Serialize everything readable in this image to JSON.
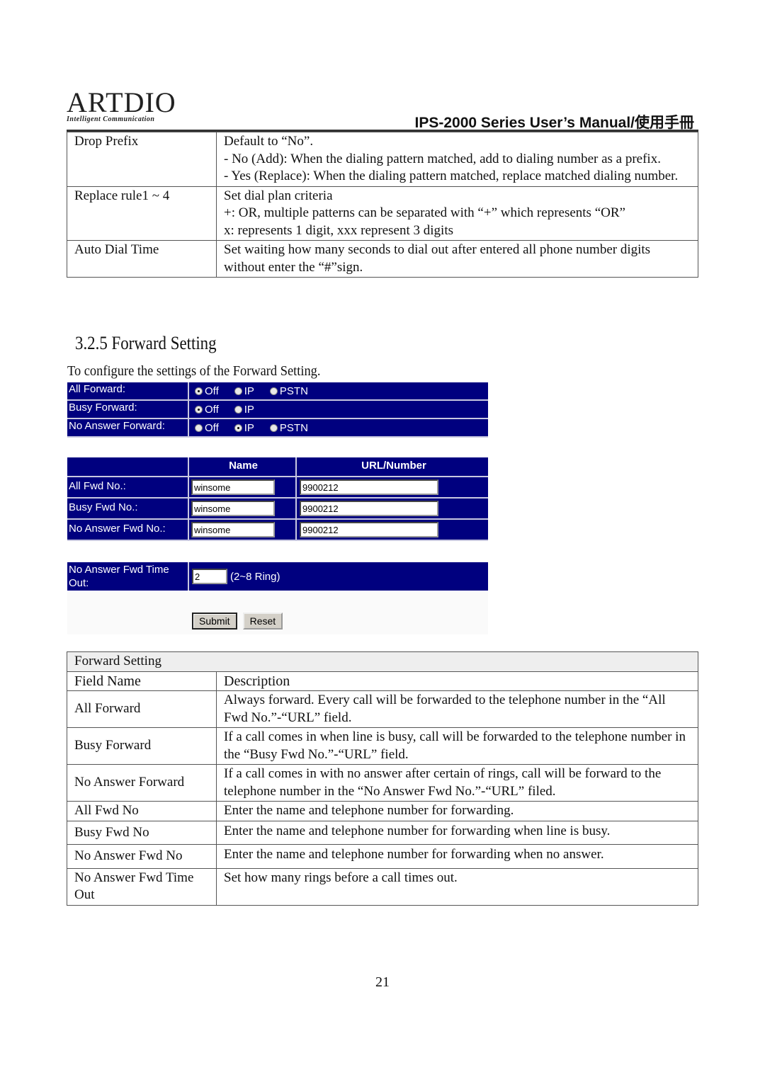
{
  "header": {
    "logo_main": "ARTDIO",
    "logo_tagline": "Intelligent Communication",
    "manual_title": "IPS-2000 Series User’s Manual/使用手冊"
  },
  "top_table": {
    "rows": [
      {
        "field": "Drop Prefix",
        "lines": [
          "Default to “No”.",
          "- No (Add): When the dialing pattern matched, add to dialing number as a prefix.",
          "- Yes (Replace): When the dialing pattern matched, replace matched dialing number."
        ]
      },
      {
        "field": "Replace rule1 ~ 4",
        "lines": [
          "Set dial plan criteria",
          "+: OR, multiple patterns can be separated with “+” which represents “OR”",
          "x: represents 1 digit, xxx represent 3 digits"
        ]
      },
      {
        "field": "Auto Dial Time",
        "lines": [
          "Set waiting how many seconds to dial out after entered all phone number digits without enter the “#”sign."
        ]
      }
    ]
  },
  "section": {
    "title": "3.2.5 Forward Setting",
    "intro": "To configure the settings of the Forward Setting."
  },
  "forward_form": {
    "modes": [
      {
        "label": "All Forward:",
        "options": [
          "Off",
          "IP",
          "PSTN"
        ],
        "selected": "Off"
      },
      {
        "label": "Busy Forward:",
        "options": [
          "Off",
          "IP"
        ],
        "selected": "Off"
      },
      {
        "label": "No Answer Forward:",
        "options": [
          "Off",
          "IP",
          "PSTN"
        ],
        "selected": "IP"
      }
    ],
    "grid_headers": {
      "name": "Name",
      "url": "URL/Number"
    },
    "numbers": [
      {
        "label": "All Fwd No.:",
        "name": "winsome",
        "url": "9900212"
      },
      {
        "label": "Busy Fwd No.:",
        "name": "winsome",
        "url": "9900212"
      },
      {
        "label": "No Answer Fwd No.:",
        "name": "winsome",
        "url": "9900212"
      }
    ],
    "timeout": {
      "label": "No Answer Fwd Time Out:",
      "value": "2",
      "hint": "(2~8 Ring)"
    },
    "submit_label": "Submit",
    "reset_label": "Reset"
  },
  "desc_table": {
    "caption": "Forward Setting",
    "col_field": "Field Name",
    "col_desc": "Description",
    "rows": [
      {
        "field": "All Forward",
        "desc": "Always forward. Every call will be forwarded to the telephone number in the “All Fwd No.”-“URL” field."
      },
      {
        "field": "Busy Forward",
        "desc": "If a call comes in when line is busy, call will be forwarded to the telephone number in the “Busy Fwd No.”-“URL” field."
      },
      {
        "field": "No Answer Forward",
        "desc": "If a call comes in with no answer after certain of rings, call will be forward to the telephone number in the “No Answer Fwd No.”-“URL” filed."
      },
      {
        "field": "All Fwd No",
        "desc": "Enter the name and telephone number for forwarding."
      },
      {
        "field": "Busy Fwd No",
        "desc": "Enter the name and telephone number for forwarding when line is busy."
      },
      {
        "field": "No Answer Fwd No",
        "desc": "Enter the name and telephone number for forwarding when no answer."
      },
      {
        "field": "No Answer Fwd Time Out",
        "desc": "Set how many rings before a call times out."
      }
    ]
  },
  "page_number": "21"
}
